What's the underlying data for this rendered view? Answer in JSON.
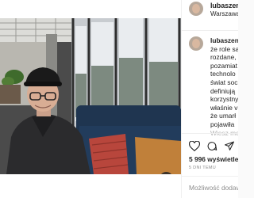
{
  "post": {
    "username": "lubaszenk",
    "location": "Warszawa",
    "caption_user": "lubaszenk",
    "caption_lines": [
      "że role są",
      "rozdane,",
      "pozamiat",
      "technolo",
      "świat soc",
      "definiują",
      "korzystny",
      "właśnie v",
      "że umarł",
      "pojawiła",
      "Wiesz me"
    ],
    "likes": "5 996 wyświetleń",
    "timestamp": "5 DNI TEMU",
    "comment_placeholder": "Możliwość dodaw"
  },
  "icons": {
    "mute": "speaker-muted-icon",
    "like": "heart-icon",
    "comment": "comment-icon",
    "share": "share-icon"
  },
  "colors": {
    "meta_text": "#8e8e8e",
    "mute_button": "#262626"
  }
}
